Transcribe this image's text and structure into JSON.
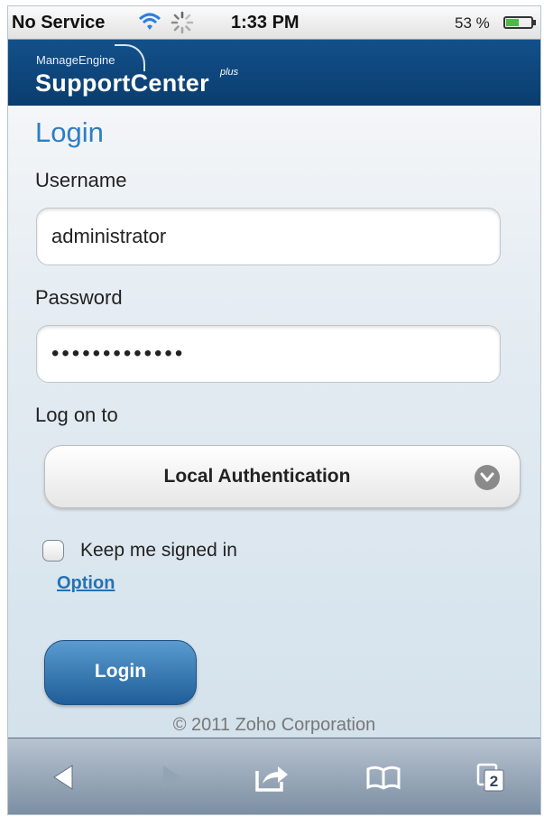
{
  "status_bar": {
    "carrier": "No Service",
    "time": "1:33 PM",
    "battery": "53 %",
    "battery_level": 0.53,
    "icons": [
      "wifi-icon",
      "loading-spinner-icon",
      "battery-icon"
    ]
  },
  "header": {
    "brand_small": "ManageEngine",
    "brand_main": "SupportCenter",
    "brand_plus": "plus"
  },
  "login": {
    "title": "Login",
    "username_label": "Username",
    "username_value": "administrator",
    "password_label": "Password",
    "password_value": "•••••••••••••",
    "logon_label": "Log on to",
    "logon_value": "Local Authentication",
    "keep_signed_in": "Keep me signed in",
    "keep_signed_in_checked": false,
    "option_link": "Option",
    "login_button": "Login"
  },
  "footer": {
    "copyright": "© 2011 Zoho Corporation"
  },
  "toolbar": {
    "icons": [
      "back-icon",
      "forward-icon",
      "share-icon",
      "bookmarks-icon",
      "tabs-icon"
    ],
    "tabs_count": "2"
  },
  "colors": {
    "accent": "#2d7ec4",
    "header_bg": "#0a3d6e",
    "button": "#2f6ea8",
    "link": "#2672b5"
  }
}
